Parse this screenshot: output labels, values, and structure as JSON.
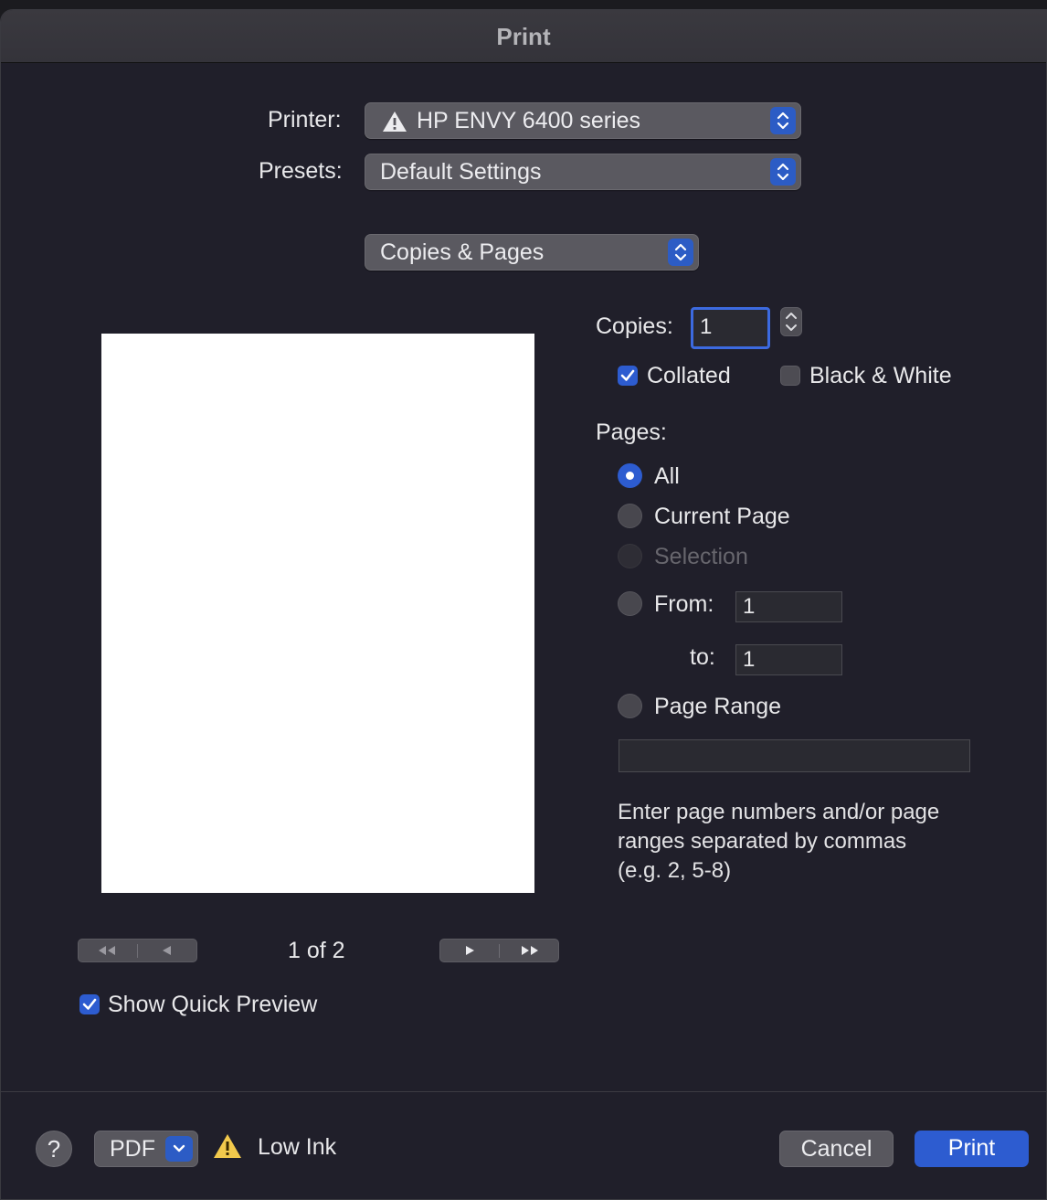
{
  "window": {
    "title": "Print"
  },
  "printer": {
    "label": "Printer:",
    "value": "HP ENVY 6400 series"
  },
  "presets": {
    "label": "Presets:",
    "value": "Default Settings"
  },
  "section": {
    "value": "Copies & Pages"
  },
  "copies": {
    "label": "Copies:",
    "value": "1",
    "collated_label": "Collated",
    "collated_checked": true,
    "bw_label": "Black & White",
    "bw_checked": false
  },
  "pages": {
    "label": "Pages:",
    "all_label": "All",
    "current_label": "Current Page",
    "selection_label": "Selection",
    "from_label": "From:",
    "from_value": "1",
    "to_label": "to:",
    "to_value": "1",
    "range_label": "Page Range",
    "range_value": "",
    "hint": "Enter page numbers and/or page ranges separated by commas (e.g. 2, 5-8)",
    "selected": "All"
  },
  "preview": {
    "page_indicator": "1 of 2",
    "show_quick_preview_label": "Show Quick Preview",
    "show_quick_preview_checked": true
  },
  "footer": {
    "help_label": "?",
    "pdf_label": "PDF",
    "status_label": "Low Ink",
    "cancel_label": "Cancel",
    "print_label": "Print"
  },
  "colors": {
    "accent": "#2d5cd0",
    "background": "#201f2a",
    "warning": "#f2c94c"
  }
}
